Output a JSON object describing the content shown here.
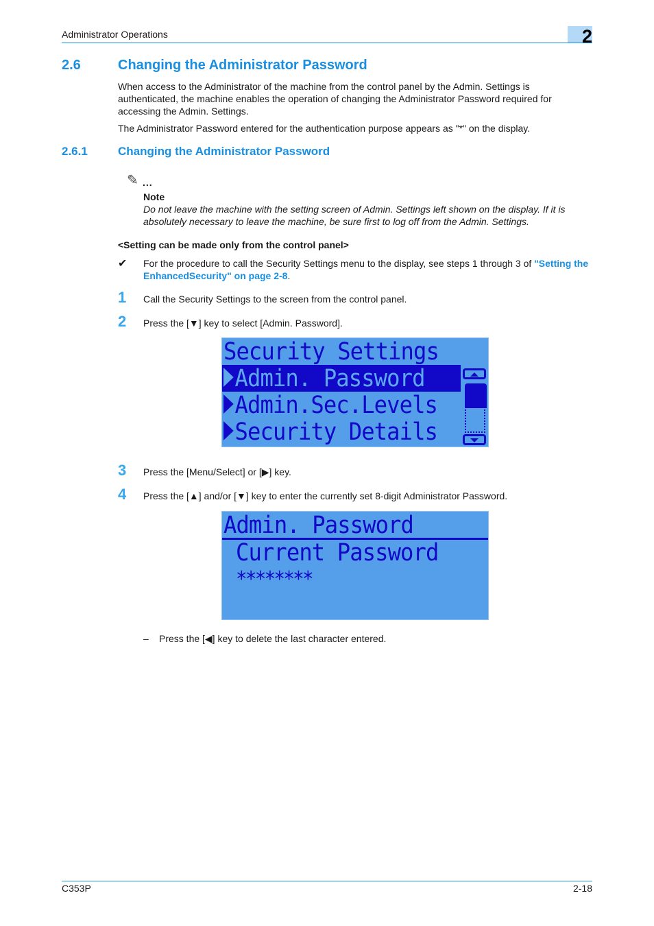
{
  "header": {
    "section_title": "Administrator Operations",
    "chapter_number": "2"
  },
  "section": {
    "number": "2.6",
    "title": "Changing the Administrator Password",
    "paragraphs": [
      "When access to the Administrator of the machine from the control panel by the Admin. Settings is authenticated, the machine enables the operation of changing the Administrator Password required for accessing the Admin. Settings.",
      "The Administrator Password entered for the authentication purpose appears as \"*\" on the display."
    ]
  },
  "subsection": {
    "number": "2.6.1",
    "title": "Changing the Administrator Password"
  },
  "note": {
    "icon": "pencil-note-icon",
    "dots": "...",
    "label": "Note",
    "text": "Do not leave the machine with the setting screen of Admin. Settings left shown on the display. If it is absolutely necessary to leave the machine, be sure first to log off from the Admin. Settings."
  },
  "subheading": "<Setting can be made only from the control panel>",
  "prerequisite": {
    "icon": "checkmark-icon",
    "text_before": "For the procedure to call the Security Settings menu to the display, see steps 1 through 3 of ",
    "link_text": "\"Setting the EnhancedSecurity\" on page 2-8",
    "text_after": "."
  },
  "steps": [
    {
      "number": "1",
      "text": "Call the Security Settings to the screen from the control panel."
    },
    {
      "number": "2",
      "text": "Press the [▼] key to select [Admin. Password]."
    },
    {
      "number": "3",
      "text": "Press the [Menu/Select] or [▶] key."
    },
    {
      "number": "4",
      "text": "Press the [▲] and/or [▼] key to enter the currently set 8-digit Administrator Password."
    }
  ],
  "lcd_security_settings": {
    "title": "Security Settings",
    "items": [
      {
        "label": "Admin. Password",
        "selected": true
      },
      {
        "label": "Admin.Sec.Levels",
        "selected": false
      },
      {
        "label": "Security Details",
        "selected": false
      }
    ],
    "scrollbar": {
      "up_icon": "scroll-up-icon",
      "down_icon": "scroll-down-icon"
    }
  },
  "lcd_admin_password": {
    "title": "Admin. Password",
    "label": "Current Password",
    "masked_value": "********"
  },
  "sub_step": {
    "dash": "–",
    "text": "Press the [◀] key to delete the last character entered."
  },
  "footer": {
    "model": "C353P",
    "page": "2-18"
  },
  "colors": {
    "accent": "#1a8fe0",
    "lcd_background": "#559ee9",
    "lcd_text": "#1208c8"
  }
}
